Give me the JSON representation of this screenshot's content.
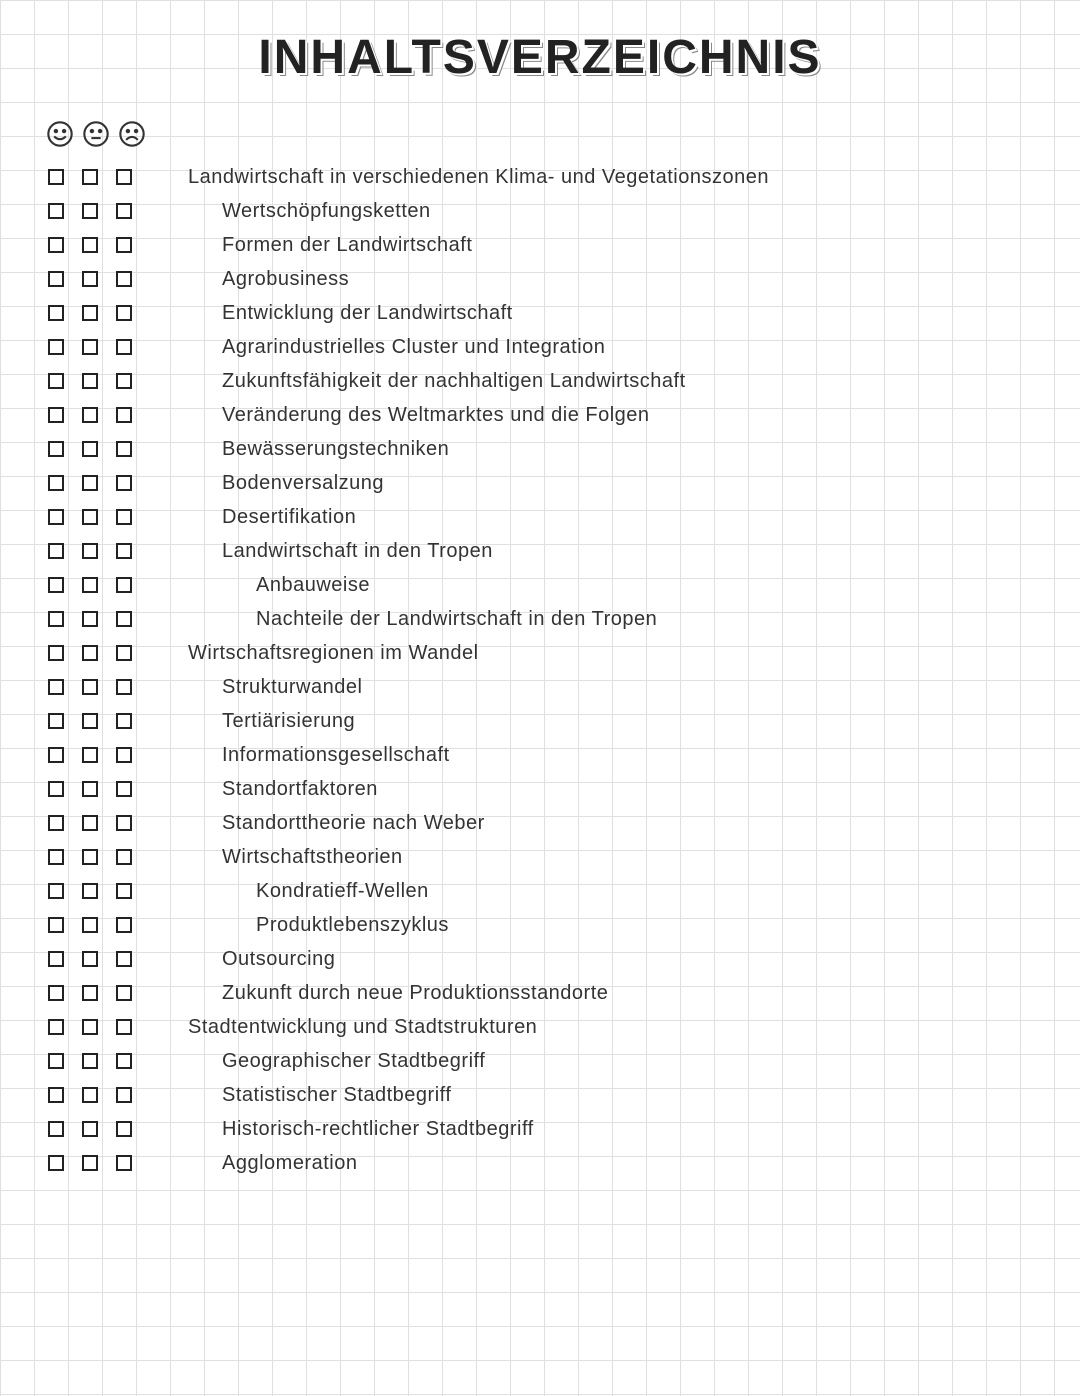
{
  "title": "INHALTSVERZEICHNIS",
  "header_icons": [
    "happy-face-icon",
    "neutral-face-icon",
    "sad-face-icon"
  ],
  "rows": [
    {
      "indent": 0,
      "text": "Landwirtschaft in verschiedenen Klima- und Vegetationszonen"
    },
    {
      "indent": 1,
      "text": "Wertschöpfungsketten"
    },
    {
      "indent": 1,
      "text": "Formen der Landwirtschaft"
    },
    {
      "indent": 1,
      "text": "Agrobusiness"
    },
    {
      "indent": 1,
      "text": "Entwicklung der Landwirtschaft"
    },
    {
      "indent": 1,
      "text": "Agrarindustrielles Cluster und Integration"
    },
    {
      "indent": 1,
      "text": "Zukunftsfähigkeit der nachhaltigen Landwirtschaft"
    },
    {
      "indent": 1,
      "text": "Veränderung des Weltmarktes und die Folgen"
    },
    {
      "indent": 1,
      "text": "Bewässerungstechniken"
    },
    {
      "indent": 1,
      "text": "Bodenversalzung"
    },
    {
      "indent": 1,
      "text": "Desertifikation"
    },
    {
      "indent": 1,
      "text": "Landwirtschaft in den Tropen"
    },
    {
      "indent": 2,
      "text": "Anbauweise"
    },
    {
      "indent": 2,
      "text": "Nachteile der Landwirtschaft in den Tropen"
    },
    {
      "indent": 0,
      "text": "Wirtschaftsregionen im Wandel"
    },
    {
      "indent": 1,
      "text": "Strukturwandel"
    },
    {
      "indent": 1,
      "text": "Tertiärisierung"
    },
    {
      "indent": 1,
      "text": "Informationsgesellschaft"
    },
    {
      "indent": 1,
      "text": "Standortfaktoren"
    },
    {
      "indent": 1,
      "text": "Standorttheorie nach Weber"
    },
    {
      "indent": 1,
      "text": "Wirtschaftstheorien"
    },
    {
      "indent": 2,
      "text": "Kondratieff-Wellen"
    },
    {
      "indent": 2,
      "text": "Produktlebenszyklus"
    },
    {
      "indent": 1,
      "text": "Outsourcing"
    },
    {
      "indent": 1,
      "text": "Zukunft durch neue Produktionsstandorte"
    },
    {
      "indent": 0,
      "text": "Stadtentwicklung und Stadtstrukturen"
    },
    {
      "indent": 1,
      "text": "Geographischer Stadtbegriff"
    },
    {
      "indent": 1,
      "text": "Statistischer Stadtbegriff"
    },
    {
      "indent": 1,
      "text": "Historisch-rechtlicher Stadtbegriff"
    },
    {
      "indent": 1,
      "text": "Agglomeration"
    }
  ]
}
